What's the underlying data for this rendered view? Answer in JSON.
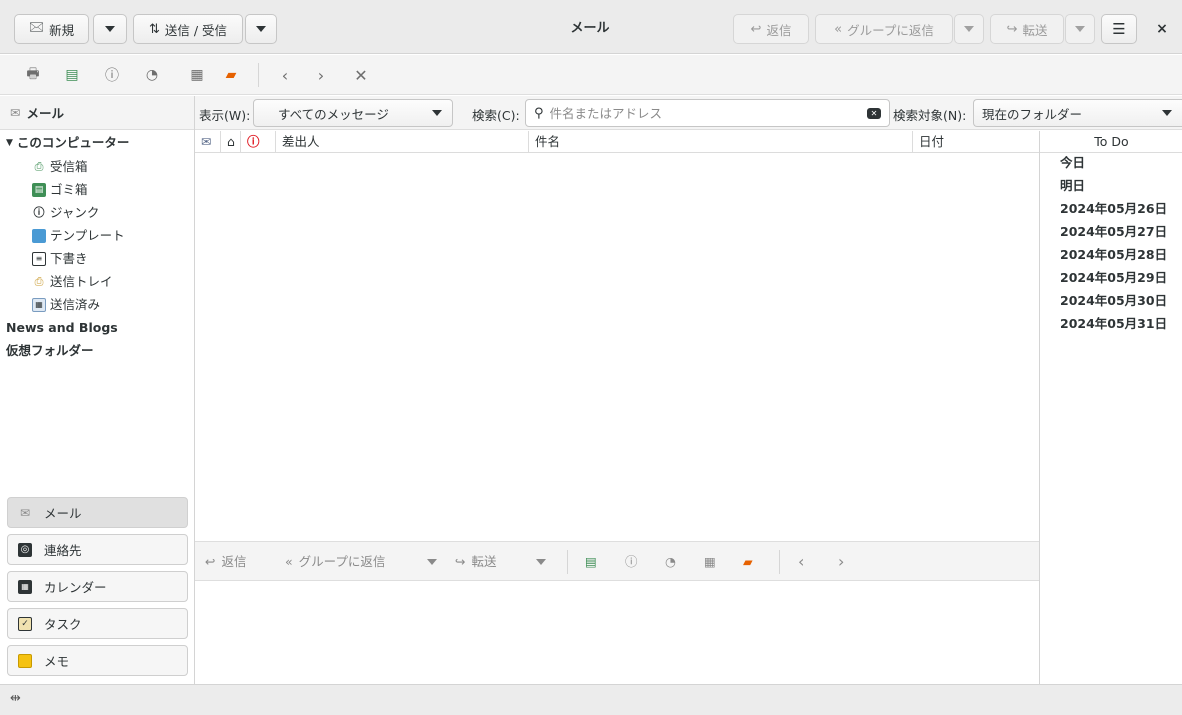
{
  "header": {
    "new_label": "新規",
    "getmsg_label": "送信 / 受信",
    "title": "メール",
    "reply_label": "返信",
    "reply_all_label": "グループに返信",
    "forward_label": "転送",
    "close_glyph": "×"
  },
  "folder_pane": {
    "header": "メール",
    "account": "このコンピューター",
    "folders": [
      {
        "label": "受信箱",
        "icon": "inbox-icon"
      },
      {
        "label": "ゴミ箱",
        "icon": "trash-icon"
      },
      {
        "label": "ジャンク",
        "icon": "junk-icon"
      },
      {
        "label": "テンプレート",
        "icon": "templates-icon"
      },
      {
        "label": "下書き",
        "icon": "drafts-icon"
      },
      {
        "label": "送信トレイ",
        "icon": "outbox-icon"
      },
      {
        "label": "送信済み",
        "icon": "sent-icon"
      }
    ],
    "other_accounts": [
      "News and Blogs",
      "仮想フォルダー"
    ]
  },
  "modes": [
    {
      "label": "メール",
      "icon": "mail-icon",
      "active": true
    },
    {
      "label": "連絡先",
      "icon": "contacts-icon",
      "active": false
    },
    {
      "label": "カレンダー",
      "icon": "calendar-icon",
      "active": false
    },
    {
      "label": "タスク",
      "icon": "tasks-icon",
      "active": false
    },
    {
      "label": "メモ",
      "icon": "memos-icon",
      "active": false
    }
  ],
  "filter": {
    "show_label": "表示(W):",
    "show_value": "すべてのメッセージ",
    "search_label": "検索(C):",
    "search_placeholder": "件名またはアドレス",
    "scope_label": "検索対象(N):",
    "scope_value": "現在のフォルダー"
  },
  "columns": {
    "from": "差出人",
    "subject": "件名",
    "date": "日付"
  },
  "preview_toolbar": {
    "reply": "返信",
    "reply_all": "グループに返信",
    "forward": "転送"
  },
  "todo": {
    "title": "To Do",
    "days": [
      "今日",
      "明日",
      "2024年05月26日",
      "2024年05月27日",
      "2024年05月28日",
      "2024年05月29日",
      "2024年05月30日",
      "2024年05月31日"
    ]
  },
  "colors": {
    "accent": "#3584e4",
    "junk_red": "#e01b24",
    "trash_green": "#3f8f56",
    "template_blue": "#4a9ad4",
    "memo_yellow": "#f5c211"
  }
}
